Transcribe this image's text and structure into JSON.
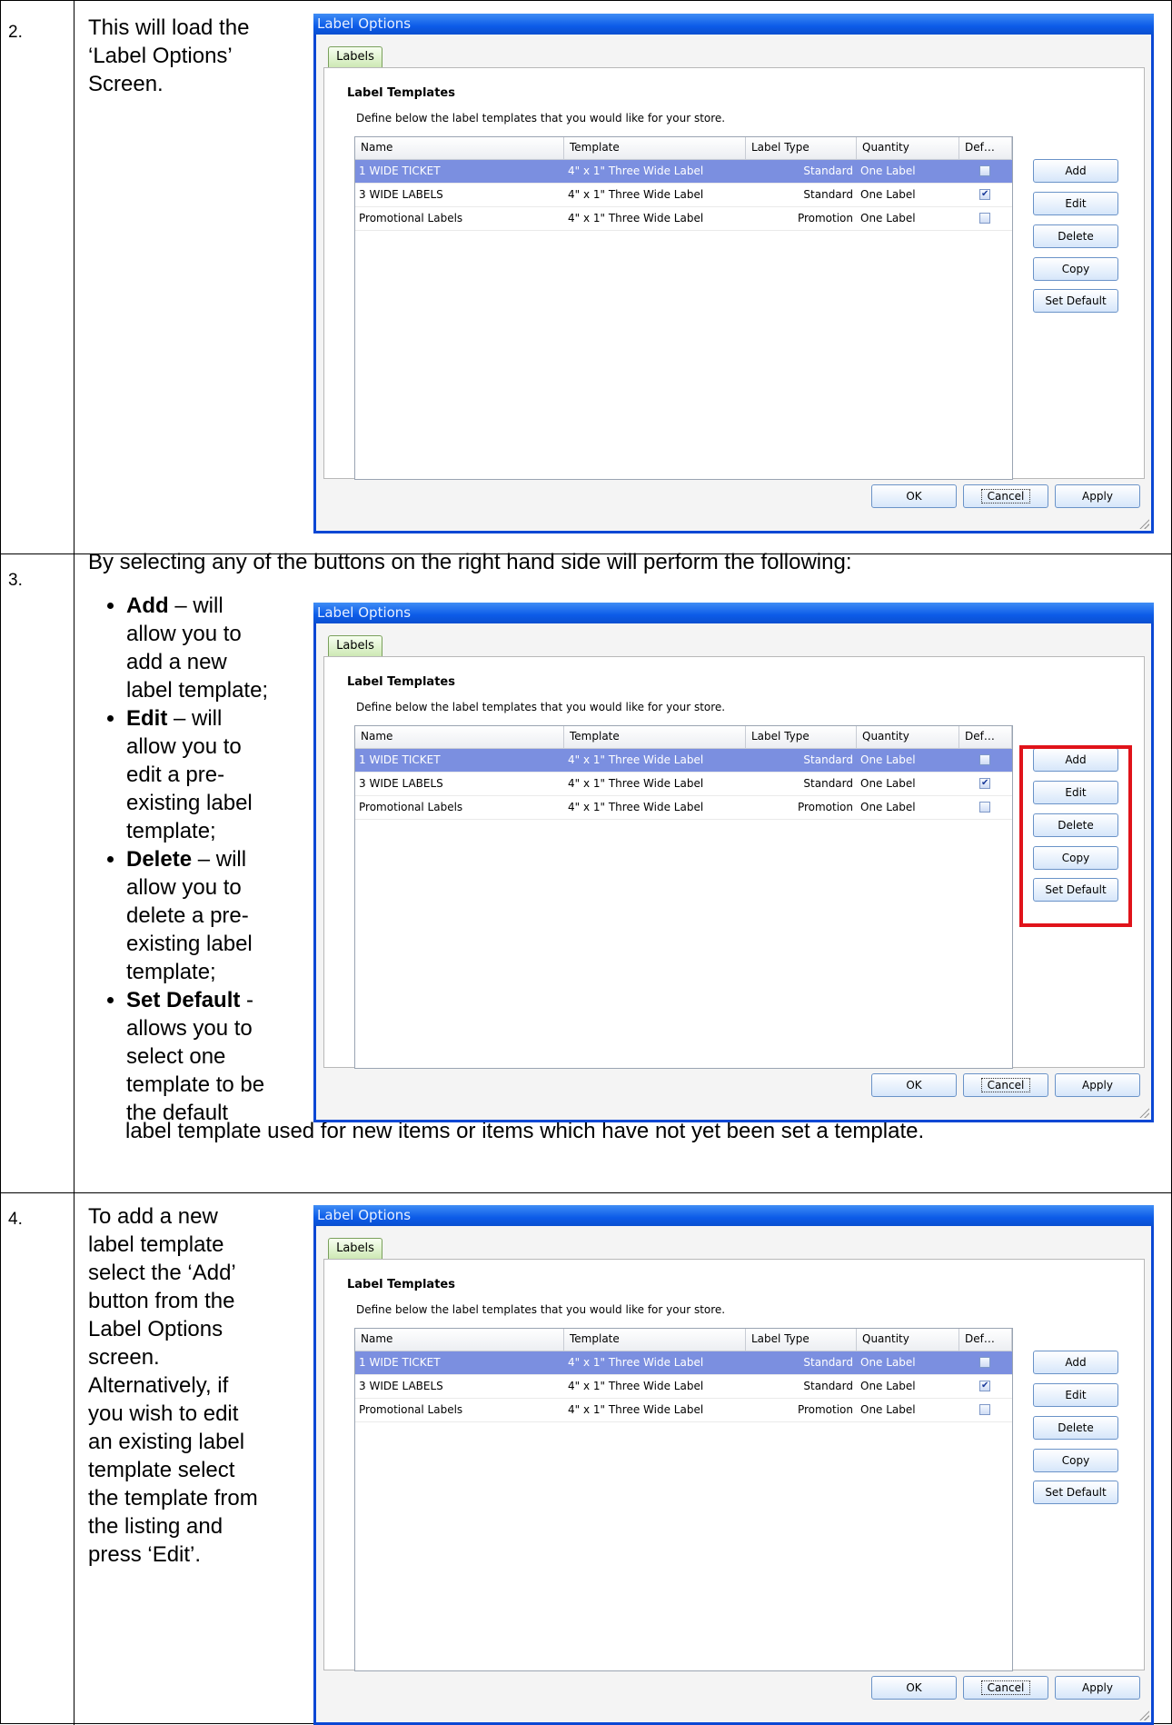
{
  "rows": [
    {
      "number": "2.",
      "text": [
        "This will load the",
        "‘Label Options’",
        "Screen."
      ]
    },
    {
      "number": "3.",
      "intro": "By selecting any of the buttons on the right hand side will perform the following:",
      "bullets": [
        {
          "term": "Add",
          "sep": " – ",
          "lines": [
            "will",
            "allow you to",
            "add a new",
            "label template;"
          ]
        },
        {
          "term": "Edit",
          "sep": " – ",
          "lines": [
            "will",
            "allow you to",
            "edit a pre-",
            "existing label",
            "template;"
          ]
        },
        {
          "term": "Delete",
          "sep": " – ",
          "lines": [
            "will",
            "allow you to",
            "delete a pre-",
            "existing label",
            "template;"
          ]
        },
        {
          "term": "Set Default",
          "sep": " - ",
          "lines": [
            "",
            "allows you to",
            "select one",
            "template to be",
            "the default"
          ]
        }
      ],
      "continuation": "label template used for new items or items which have not yet been set a template."
    },
    {
      "number": "4.",
      "text": [
        "To add a new",
        "label template",
        "select the ‘Add’",
        "button from the",
        "Label Options",
        "screen.",
        "Alternatively, if",
        "you wish to edit",
        "an existing label",
        "template select",
        "the template from",
        "the listing and",
        "press ‘Edit’."
      ]
    }
  ],
  "dialog": {
    "title": "Label Options",
    "tab": "Labels",
    "section_title": "Label Templates",
    "description": "Define below the label templates that you would like for your store.",
    "columns": [
      "Name",
      "Template",
      "Label Type",
      "Quantity",
      "Def…"
    ],
    "templates": [
      {
        "name": "1 WIDE TICKET",
        "template": "4\" x 1\" Three Wide Label",
        "type": "Standard",
        "quantity": "One Label",
        "default": false,
        "selected": true
      },
      {
        "name": "3 WIDE LABELS",
        "template": "4\" x 1\" Three Wide Label",
        "type": "Standard",
        "quantity": "One Label",
        "default": true,
        "selected": false
      },
      {
        "name": "Promotional Labels",
        "template": "4\" x 1\" Three Wide Label",
        "type": "Promotion",
        "quantity": "One Label",
        "default": false,
        "selected": false
      }
    ],
    "side_buttons": [
      "Add",
      "Edit",
      "Delete",
      "Copy",
      "Set Default"
    ],
    "ok": "OK",
    "cancel": "Cancel",
    "apply": "Apply"
  }
}
